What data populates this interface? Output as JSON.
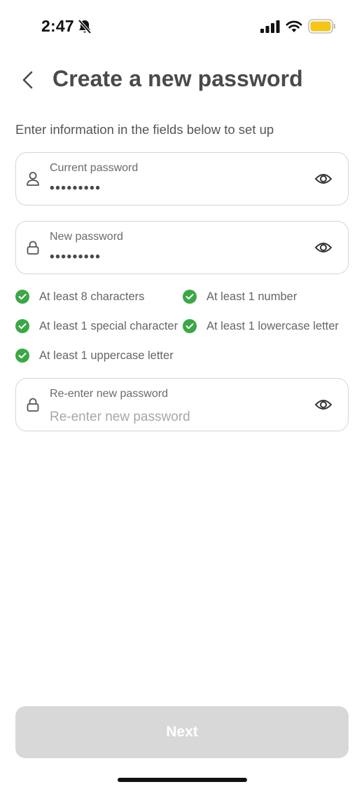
{
  "status_bar": {
    "time": "2:47",
    "icons": [
      "bell-slash-icon",
      "cellular-signal-icon",
      "wifi-icon",
      "battery-icon"
    ],
    "battery_color": "#f5c518"
  },
  "header": {
    "back_icon": "chevron-left-icon",
    "title": "Create a new password"
  },
  "subtitle": "Enter information in the fields below to set up",
  "fields": {
    "current": {
      "label": "Current password",
      "value": "•••••••••",
      "icon": "user-icon",
      "toggle_icon": "eye-icon"
    },
    "new": {
      "label": "New password",
      "value": "•••••••••",
      "icon": "lock-icon",
      "toggle_icon": "eye-icon"
    },
    "confirm": {
      "label": "Re-enter new password",
      "placeholder": "Re-enter new password",
      "value": "",
      "icon": "lock-icon",
      "toggle_icon": "eye-icon"
    }
  },
  "rules": [
    {
      "text": "At least 8 characters",
      "met": true
    },
    {
      "text": "At least 1 number",
      "met": true
    },
    {
      "text": "At least 1 special character",
      "met": true
    },
    {
      "text": "At least 1 lowercase letter",
      "met": true
    },
    {
      "text": "At least 1 uppercase letter",
      "met": true
    }
  ],
  "colors": {
    "check": "#3aa845",
    "button_disabled": "#d8d8d8",
    "title": "#4a4a4a"
  },
  "next_label": "Next"
}
